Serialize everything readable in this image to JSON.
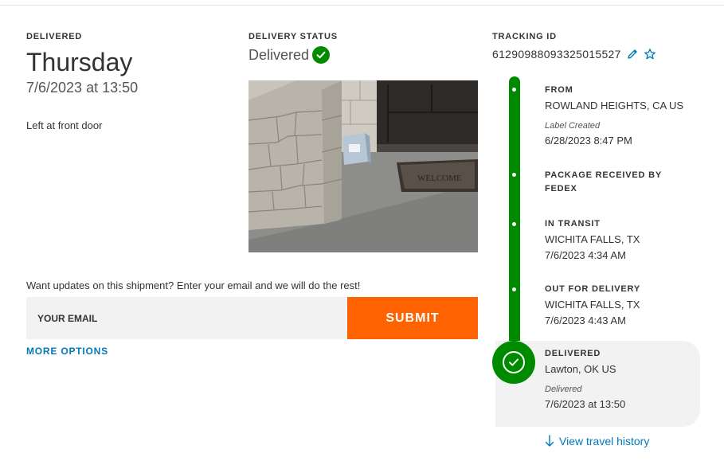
{
  "delivered_section": {
    "label": "DELIVERED",
    "day": "Thursday",
    "datetime": "7/6/2023 at 13:50",
    "left_at": "Left at front door"
  },
  "status_section": {
    "label": "DELIVERY STATUS",
    "status": "Delivered",
    "photo_icon": "delivery-photo"
  },
  "tracking_section": {
    "label": "TRACKING ID",
    "number": "612909880933250 15527",
    "number_display": "612909880933250155 27",
    "edit_icon": "pencil-icon",
    "star_icon": "star-outline-icon"
  },
  "email_section": {
    "prompt": "Want updates on this shipment? Enter your email and we will do the rest!",
    "placeholder": "YOUR EMAIL",
    "value": "",
    "submit_label": "SUBMIT",
    "more_options": "MORE OPTIONS"
  },
  "timeline": {
    "events": [
      {
        "title": "FROM",
        "location": "ROWLAND HEIGHTS, CA US",
        "note": "Label Created",
        "time": "6/28/2023 8:47 PM"
      },
      {
        "title": "PACKAGE RECEIVED BY",
        "title2": "FEDEX"
      },
      {
        "title": "IN TRANSIT",
        "location": "WICHITA FALLS, TX",
        "time": "7/6/2023 4:34 AM"
      },
      {
        "title": "OUT FOR DELIVERY",
        "location": "WICHITA FALLS, TX",
        "time": "7/6/2023 4:43 AM"
      },
      {
        "title": "DELIVERED",
        "location": "Lawton, OK US",
        "note": "Delivered",
        "time": "7/6/2023 at 13:50"
      }
    ],
    "view_history": "View travel history"
  },
  "colors": {
    "accent_orange": "#ff6200",
    "success_green": "#008a00",
    "link_blue": "#007ab7"
  }
}
